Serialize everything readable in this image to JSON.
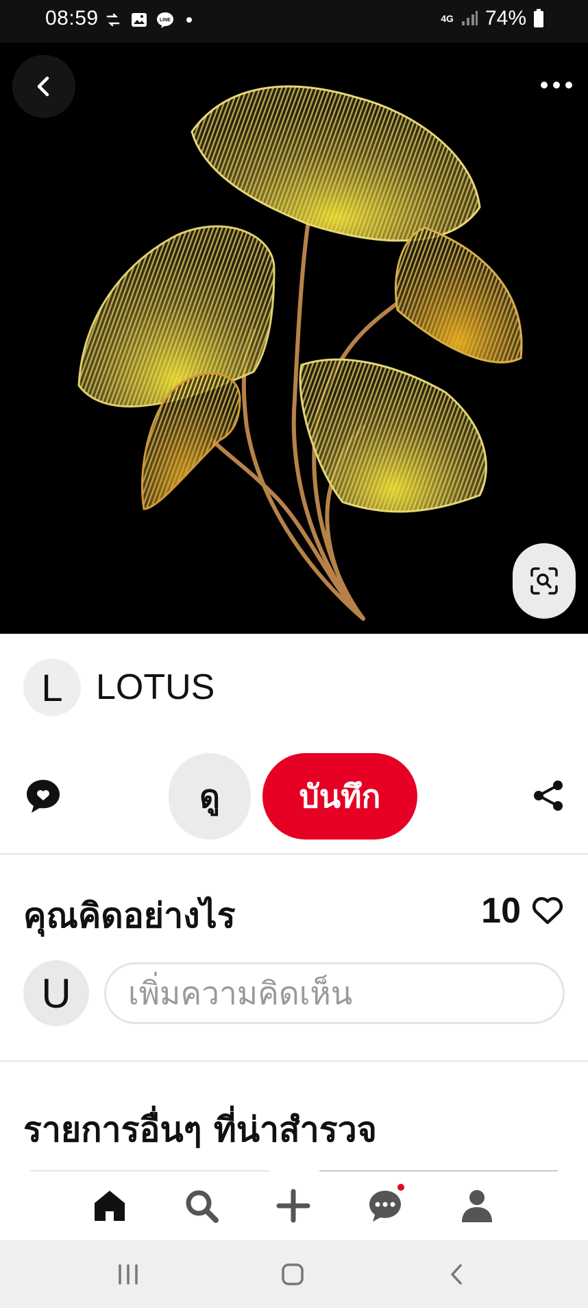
{
  "status_bar": {
    "time": "08:59",
    "network": "4G",
    "battery": "74%",
    "icons_left": [
      "data-transfer-icon",
      "image-notification-icon",
      "line-notification-icon"
    ]
  },
  "pin": {
    "image_description_icon": "ginkgo-leaf-art",
    "creator_initial": "L",
    "creator_name": "LOTUS"
  },
  "actions": {
    "view_label": "ดู",
    "save_label": "บันทึก",
    "save_color": "#e60023"
  },
  "comments": {
    "title": "คุณคิดอย่างไร",
    "likes": "10",
    "user_initial": "U",
    "placeholder": "เพิ่มความคิดเห็น"
  },
  "more": {
    "title": "รายการอื่นๆ ที่น่าสำรวจ"
  },
  "bottom_nav": {
    "items": [
      "home-icon",
      "search-icon",
      "create-icon",
      "messages-icon",
      "profile-icon"
    ]
  }
}
